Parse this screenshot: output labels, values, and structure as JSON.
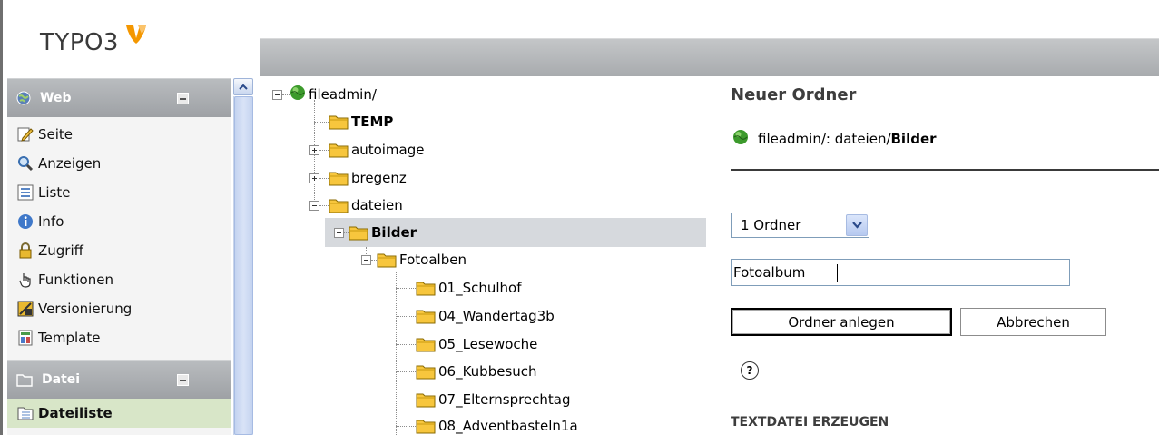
{
  "app": {
    "logo_text": "TYPO3"
  },
  "sidebar": {
    "sections": [
      {
        "label": "Web",
        "items": [
          {
            "label": "Seite",
            "icon": "page-edit-icon"
          },
          {
            "label": "Anzeigen",
            "icon": "magnifier-icon"
          },
          {
            "label": "Liste",
            "icon": "list-icon"
          },
          {
            "label": "Info",
            "icon": "info-icon"
          },
          {
            "label": "Zugriff",
            "icon": "lock-icon"
          },
          {
            "label": "Funktionen",
            "icon": "hand-pointer-icon"
          },
          {
            "label": "Versionierung",
            "icon": "versioning-icon"
          },
          {
            "label": "Template",
            "icon": "template-icon"
          }
        ]
      },
      {
        "label": "Datei",
        "items": [
          {
            "label": "Dateiliste",
            "icon": "filelist-icon",
            "active": true
          }
        ]
      }
    ]
  },
  "tree": {
    "root": "fileadmin/",
    "nodes": [
      {
        "label": "TEMP"
      },
      {
        "label": "autoimage"
      },
      {
        "label": "bregenz"
      },
      {
        "label": "dateien"
      },
      {
        "label": "Bilder",
        "selected": true
      },
      {
        "label": "Fotoalben"
      },
      {
        "label": "01_Schulhof"
      },
      {
        "label": "04_Wandertag3b"
      },
      {
        "label": "05_Lesewoche"
      },
      {
        "label": "06_Kubbesuch"
      },
      {
        "label": "07_Elternsprechtag"
      },
      {
        "label": "08_Adventbasteln1a"
      }
    ]
  },
  "content": {
    "title": "Neuer Ordner",
    "path_prefix": "fileadmin/: dateien/",
    "path_current": "Bilder",
    "folder_count_select": "1 Ordner",
    "folder_name_value": "Fotoalbum",
    "create_button": "Ordner anlegen",
    "cancel_button": "Abbrechen",
    "help_symbol": "?",
    "textfile_section_title": "TEXTDATEI ERZEUGEN"
  },
  "colors": {
    "logo_orange": "#f49700",
    "module_header": "#a7aaad",
    "active_item": "#d8e6c8",
    "selected_row": "#d6d9dd",
    "scrollbar": "#c4d3f0"
  }
}
